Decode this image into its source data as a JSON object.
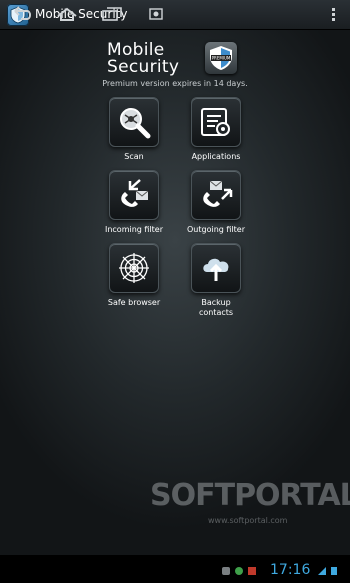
{
  "actionbar": {
    "title": "Mobile Security",
    "app_icon": "shield-icon",
    "overflow_icon": "overflow-menu-icon"
  },
  "header": {
    "logo_line1": "Mobile",
    "logo_line2": "Security",
    "logo_badge": "PREMIUM",
    "note": "Premium version expires in 14 days."
  },
  "tiles": [
    {
      "label": "Scan",
      "icon": "scan-magnifier-icon"
    },
    {
      "label": "Applications",
      "icon": "applications-icon"
    },
    {
      "label": "Incoming filter",
      "icon": "incoming-call-filter-icon"
    },
    {
      "label": "Outgoing filter",
      "icon": "outgoing-call-filter-icon"
    },
    {
      "label": "Safe browser",
      "icon": "web-spider-icon"
    },
    {
      "label": "Backup contacts",
      "icon": "cloud-upload-icon"
    }
  ],
  "statusbar": {
    "time": "17:16"
  },
  "watermark": {
    "brand": "SOFTPORTAL",
    "url": "www.softportal.com"
  },
  "colors": {
    "clock": "#3fa9e0",
    "accent": "#5aa0d6"
  }
}
